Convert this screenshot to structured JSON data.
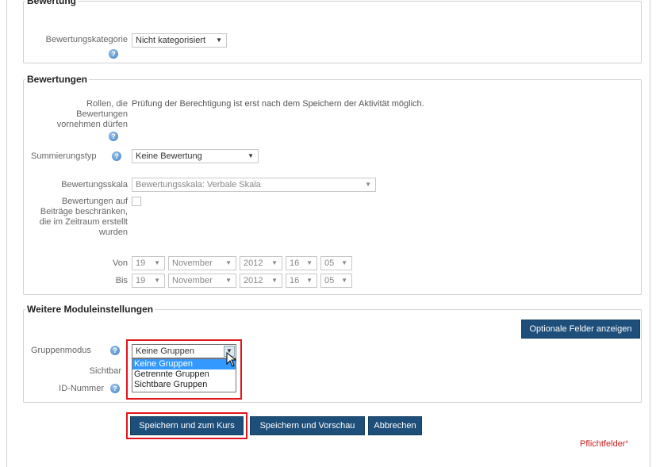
{
  "sections": {
    "bewertung": {
      "legend": "Bewertung",
      "kategorie_label": "Bewertungskategorie",
      "kategorie_value": "Nicht kategorisiert"
    },
    "bewertungen": {
      "legend": "Bewertungen",
      "rollen_label": "Rollen, die Bewertungen vornehmen dürfen",
      "rollen_text": "Prüfung der Berechtigung ist erst nach dem Speichern der Aktivität möglich.",
      "summierung_label": "Summierungstyp",
      "summierung_value": "Keine Bewertung",
      "skala_label": "Bewertungsskala",
      "skala_value": "Bewertungsskala: Verbale Skala",
      "beschraenken_label": "Bewertungen auf Beiträge beschränken, die im Zeitraum erstellt wurden",
      "von_label": "Von",
      "bis_label": "Bis",
      "von": {
        "day": "19",
        "month": "November",
        "year": "2012",
        "hour": "16",
        "minute": "05"
      },
      "bis": {
        "day": "19",
        "month": "November",
        "year": "2012",
        "hour": "16",
        "minute": "05"
      }
    },
    "weitere": {
      "legend": "Weitere Moduleinstellungen",
      "optional_button": "Optionale Felder anzeigen",
      "gruppenmodus_label": "Gruppenmodus",
      "gruppenmodus_value": "Keine Gruppen",
      "gruppenmodus_options": [
        "Keine Gruppen",
        "Getrennte Gruppen",
        "Sichtbare Gruppen"
      ],
      "sichtbar_label": "Sichtbar",
      "idnummer_label": "ID-Nummer"
    }
  },
  "buttons": {
    "save_course": "Speichern und zum Kurs",
    "save_preview": "Speichern und Vorschau",
    "cancel": "Abbrechen"
  },
  "required_note": "Pflichtfelder",
  "required_mark": "*",
  "help_icon_glyph": "?",
  "colors": {
    "button": "#1e4f7a",
    "highlight": "#e0141e",
    "selected_option": "#3399ff",
    "help": "#3d7fc8"
  }
}
